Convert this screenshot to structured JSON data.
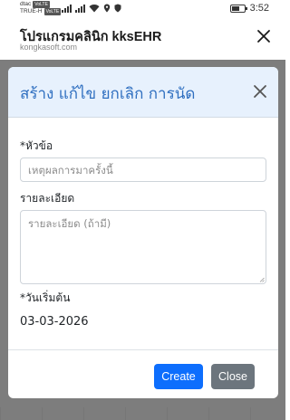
{
  "status_bar": {
    "carrier_line1": "dtac",
    "carrier_line1_tag": "VoLTE",
    "carrier_line2": "TRUE-H",
    "carrier_line2_tag": "VoLTE",
    "time": "3:52",
    "icons": [
      "signal-icon",
      "signal-icon",
      "wifi-icon",
      "location-icon",
      "shield-icon",
      "battery-icon"
    ]
  },
  "app_bar": {
    "title": "โปรแกรมคลินิก kksEHR",
    "subtitle": "kongkasoft.com",
    "close_icon": "close-icon"
  },
  "modal": {
    "title": "สร้าง แก้ไข ยกเลิก การนัด",
    "subject": {
      "label": "*หัวข้อ",
      "value": "",
      "placeholder": "เหตุผลการมาครั้งนี้"
    },
    "details": {
      "label": "รายละเอียด",
      "value": "",
      "placeholder": "รายละเอียด (ถ้ามี)"
    },
    "start_date": {
      "label": "*วันเริ่มต้น",
      "value": "03-03-2026"
    },
    "buttons": {
      "create": "Create",
      "close": "Close"
    }
  },
  "colors": {
    "modal_header_bg": "#e7f1fd",
    "modal_title": "#2f6fc0",
    "primary": "#0d6efd",
    "secondary": "#6c757d",
    "backdrop": "#7d7d7d"
  }
}
